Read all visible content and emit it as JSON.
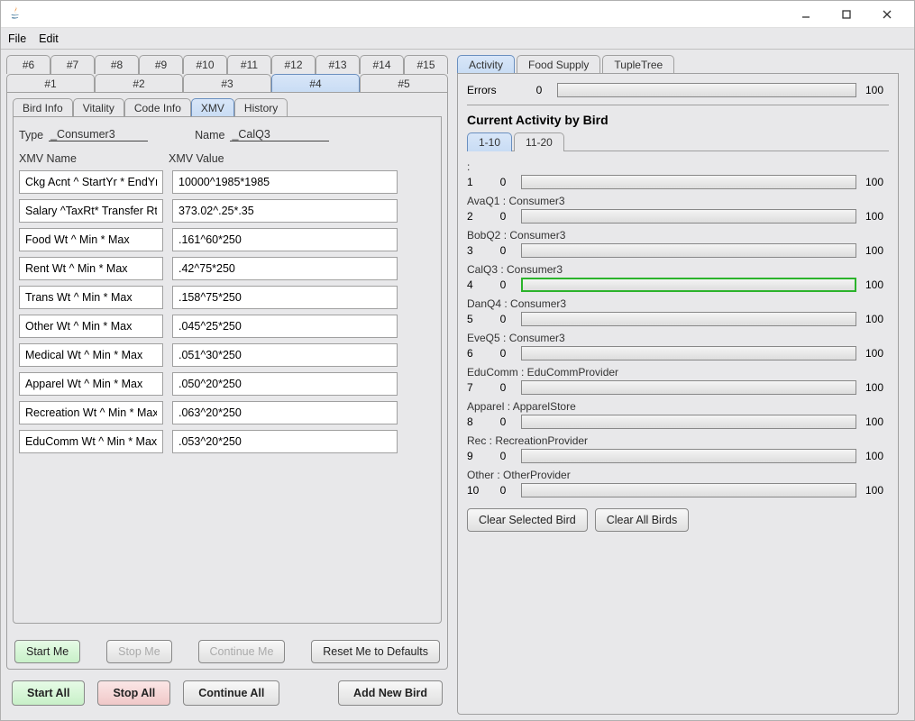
{
  "menu": {
    "file": "File",
    "edit": "Edit"
  },
  "numTabs": {
    "row1": [
      "#6",
      "#7",
      "#8",
      "#9",
      "#10",
      "#11",
      "#12",
      "#13",
      "#14",
      "#15"
    ],
    "row2": [
      "#1",
      "#2",
      "#3",
      "#4",
      "#5"
    ],
    "active": "#4"
  },
  "infoTabs": {
    "items": [
      "Bird Info",
      "Vitality",
      "Code Info",
      "XMV",
      "History"
    ],
    "active": "XMV"
  },
  "form": {
    "typeLabel": "Type",
    "type": "_Consumer3",
    "nameLabel": "Name",
    "name": "_CalQ3"
  },
  "xmvHeaders": {
    "name": "XMV Name",
    "value": "XMV Value"
  },
  "xmv": [
    {
      "name": "Ckg Acnt ^ StartYr * EndYr",
      "value": "10000^1985*1985"
    },
    {
      "name": "Salary ^TaxRt* Transfer Rt",
      "value": "373.02^.25*.35"
    },
    {
      "name": "Food Wt ^ Min * Max",
      "value": ".161^60*250"
    },
    {
      "name": "Rent Wt ^ Min * Max",
      "value": ".42^75*250"
    },
    {
      "name": "Trans Wt ^ Min * Max",
      "value": ".158^75*250"
    },
    {
      "name": "Other Wt ^ Min * Max",
      "value": ".045^25*250"
    },
    {
      "name": "Medical Wt ^ Min * Max",
      "value": ".051^30*250"
    },
    {
      "name": "Apparel Wt ^ Min * Max",
      "value": ".050^20*250"
    },
    {
      "name": "Recreation Wt ^ Min * Max",
      "value": ".063^20*250"
    },
    {
      "name": "EduComm Wt ^ Min * Max",
      "value": ".053^20*250"
    }
  ],
  "leftButtons": {
    "start": "Start Me",
    "stop": "Stop Me",
    "cont": "Continue Me",
    "reset": "Reset Me to Defaults"
  },
  "globalButtons": {
    "startAll": "Start All",
    "stopAll": "Stop All",
    "contAll": "Continue All",
    "add": "Add New Bird"
  },
  "rightTabs": {
    "items": [
      "Activity",
      "Food Supply",
      "TupleTree"
    ],
    "active": "Activity"
  },
  "errors": {
    "label": "Errors",
    "zero": "0",
    "hund": "100"
  },
  "activityTitle": "Current Activity by Bird",
  "rangeTabs": {
    "items": [
      "1-10",
      "11-20"
    ],
    "active": "1-10"
  },
  "birds": [
    {
      "id": "1",
      "label": ": ",
      "highlighted": false
    },
    {
      "id": "2",
      "label": "AvaQ1 : Consumer3",
      "highlighted": false
    },
    {
      "id": "3",
      "label": "BobQ2 : Consumer3",
      "highlighted": false
    },
    {
      "id": "4",
      "label": "CalQ3 : Consumer3",
      "highlighted": true
    },
    {
      "id": "5",
      "label": "DanQ4 : Consumer3",
      "highlighted": false
    },
    {
      "id": "6",
      "label": "EveQ5 : Consumer3",
      "highlighted": false
    },
    {
      "id": "7",
      "label": "EduComm : EduCommProvider",
      "highlighted": false
    },
    {
      "id": "8",
      "label": "Apparel : ApparelStore",
      "highlighted": false
    },
    {
      "id": "9",
      "label": "Rec : RecreationProvider",
      "highlighted": false
    },
    {
      "id": "10",
      "label": "Other : OtherProvider",
      "highlighted": false
    }
  ],
  "barZero": "0",
  "barHund": "100",
  "rightButtons": {
    "clearSel": "Clear Selected Bird",
    "clearAll": "Clear All Birds"
  }
}
